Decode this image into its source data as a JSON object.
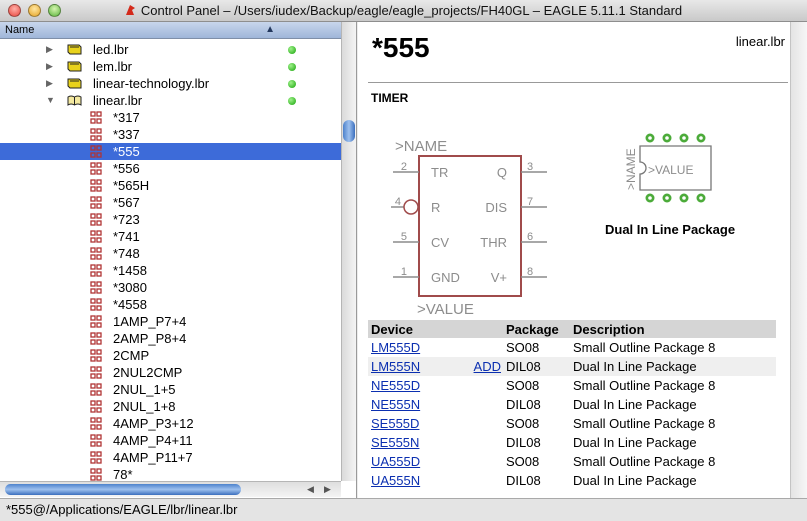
{
  "window": {
    "title": "Control Panel – /Users/iudex/Backup/eagle/eagle_projects/FH40GL – EAGLE 5.11.1 Standard",
    "status": "*555@/Applications/EAGLE/lbr/linear.lbr"
  },
  "tree": {
    "column_header": "Name",
    "libraries": [
      "led.lbr",
      "lem.lbr",
      "linear-technology.lbr",
      "linear.lbr"
    ],
    "devices": [
      "*317",
      "*337",
      "*555",
      "*556",
      "*565H",
      "*567",
      "*723",
      "*741",
      "*748",
      "*1458",
      "*3080",
      "*4558",
      "1AMP_P7+4",
      "2AMP_P8+4",
      "2CMP",
      "2NUL2CMP",
      "2NUL_1+5",
      "2NUL_1+8",
      "4AMP_P3+12",
      "4AMP_P4+11",
      "4AMP_P11+7",
      "78*"
    ]
  },
  "detail": {
    "device_title": "*555",
    "library_name": "linear.lbr",
    "description": "TIMER",
    "symbol": {
      "name_label": ">NAME",
      "value_label": ">VALUE",
      "pins": [
        {
          "num": "2",
          "name": "TR"
        },
        {
          "num": "4",
          "name": "R"
        },
        {
          "num": "5",
          "name": "CV"
        },
        {
          "num": "1",
          "name": "GND"
        },
        {
          "num": "3",
          "name": "Q"
        },
        {
          "num": "7",
          "name": "DIS"
        },
        {
          "num": "6",
          "name": "THR"
        },
        {
          "num": "8",
          "name": "V+"
        }
      ]
    },
    "package_preview": {
      "name_label": ">NAME",
      "value_label": ">VALUE",
      "caption": "Dual In Line Package"
    },
    "table": {
      "headers": [
        "Device",
        "Package",
        "Description"
      ],
      "add_label": "ADD",
      "rows": [
        {
          "device": "LM555D",
          "package": "SO08",
          "description": "Small Outline Package 8"
        },
        {
          "device": "LM555N",
          "package": "DIL08",
          "description": "Dual In Line Package"
        },
        {
          "device": "NE555D",
          "package": "SO08",
          "description": "Small Outline Package 8"
        },
        {
          "device": "NE555N",
          "package": "DIL08",
          "description": "Dual In Line Package"
        },
        {
          "device": "SE555D",
          "package": "SO08",
          "description": "Small Outline Package 8"
        },
        {
          "device": "SE555N",
          "package": "DIL08",
          "description": "Dual In Line Package"
        },
        {
          "device": "UA555D",
          "package": "SO08",
          "description": "Small Outline Package 8"
        },
        {
          "device": "UA555N",
          "package": "DIL08",
          "description": "Dual In Line Package"
        }
      ]
    }
  }
}
